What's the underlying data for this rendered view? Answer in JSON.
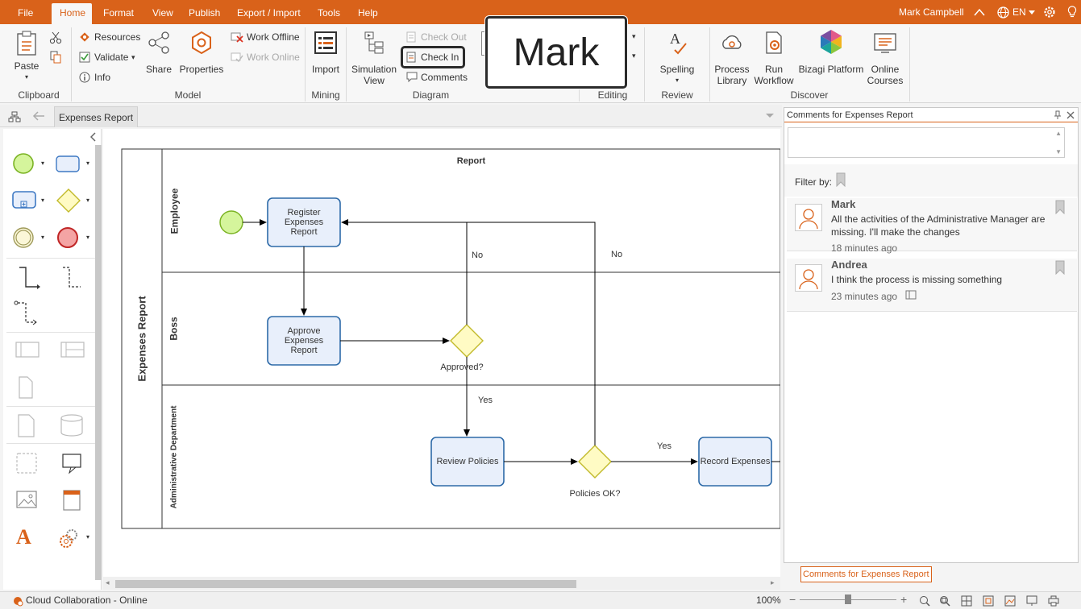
{
  "menubar": {
    "tabs": [
      "File",
      "Home",
      "Format",
      "View",
      "Publish",
      "Export / Import",
      "Tools",
      "Help"
    ],
    "active_tab": "Home",
    "user_name": "Mark Campbell",
    "language": "EN",
    "accent_color": "#d9621a"
  },
  "ribbon": {
    "clipboard": {
      "label": "Clipboard",
      "paste": "Paste"
    },
    "model": {
      "label": "Model",
      "resources": "Resources",
      "validate": "Validate",
      "info": "Info",
      "share": "Share",
      "properties": "Properties",
      "work_offline": "Work Offline",
      "work_online": "Work Online"
    },
    "mining": {
      "label": "Mining",
      "import": "Import"
    },
    "diagram": {
      "label": "Diagram",
      "simulation_view": "Simulation View",
      "check_out": "Check Out",
      "check_in": "Check In",
      "comments": "Comments"
    },
    "editing": {
      "label": "Editing"
    },
    "review": {
      "label": "Review",
      "spelling": "Spelling"
    },
    "discover": {
      "label": "Discover",
      "process_library": "Process Library",
      "run_workflow": "Run Workflow",
      "bizagi_platform": "Bizagi Platform",
      "online_courses": "Online Courses"
    }
  },
  "callout": {
    "text": "Mark"
  },
  "doc_tab": {
    "title": "Expenses Report"
  },
  "diagram": {
    "pool_name": "Expenses Report",
    "pool_header": "Report",
    "lanes": [
      "Employee",
      "Boss",
      "Administrative Department"
    ],
    "tasks": {
      "register": "Register Expenses Report",
      "approve": "Approve Expenses Report",
      "review": "Review Policies",
      "record": "Record Expenses"
    },
    "gateways": {
      "approved": "Approved?",
      "policies_ok": "Policies OK?"
    },
    "flow_labels": {
      "no1": "No",
      "no2": "No",
      "yes1": "Yes",
      "yes2": "Yes"
    }
  },
  "comments_panel": {
    "title": "Comments for Expenses Report",
    "filter_label": "Filter by:",
    "footer_tab": "Comments for Expenses Report",
    "items": [
      {
        "author": "Mark",
        "text": "All the activities of the Administrative Manager are missing. I'll make the changes",
        "time": "18 minutes ago"
      },
      {
        "author": "Andrea",
        "text": "I think the process is missing something",
        "time": "23 minutes ago"
      }
    ]
  },
  "statusbar": {
    "connection": "Cloud Collaboration - Online",
    "zoom": "100%"
  }
}
